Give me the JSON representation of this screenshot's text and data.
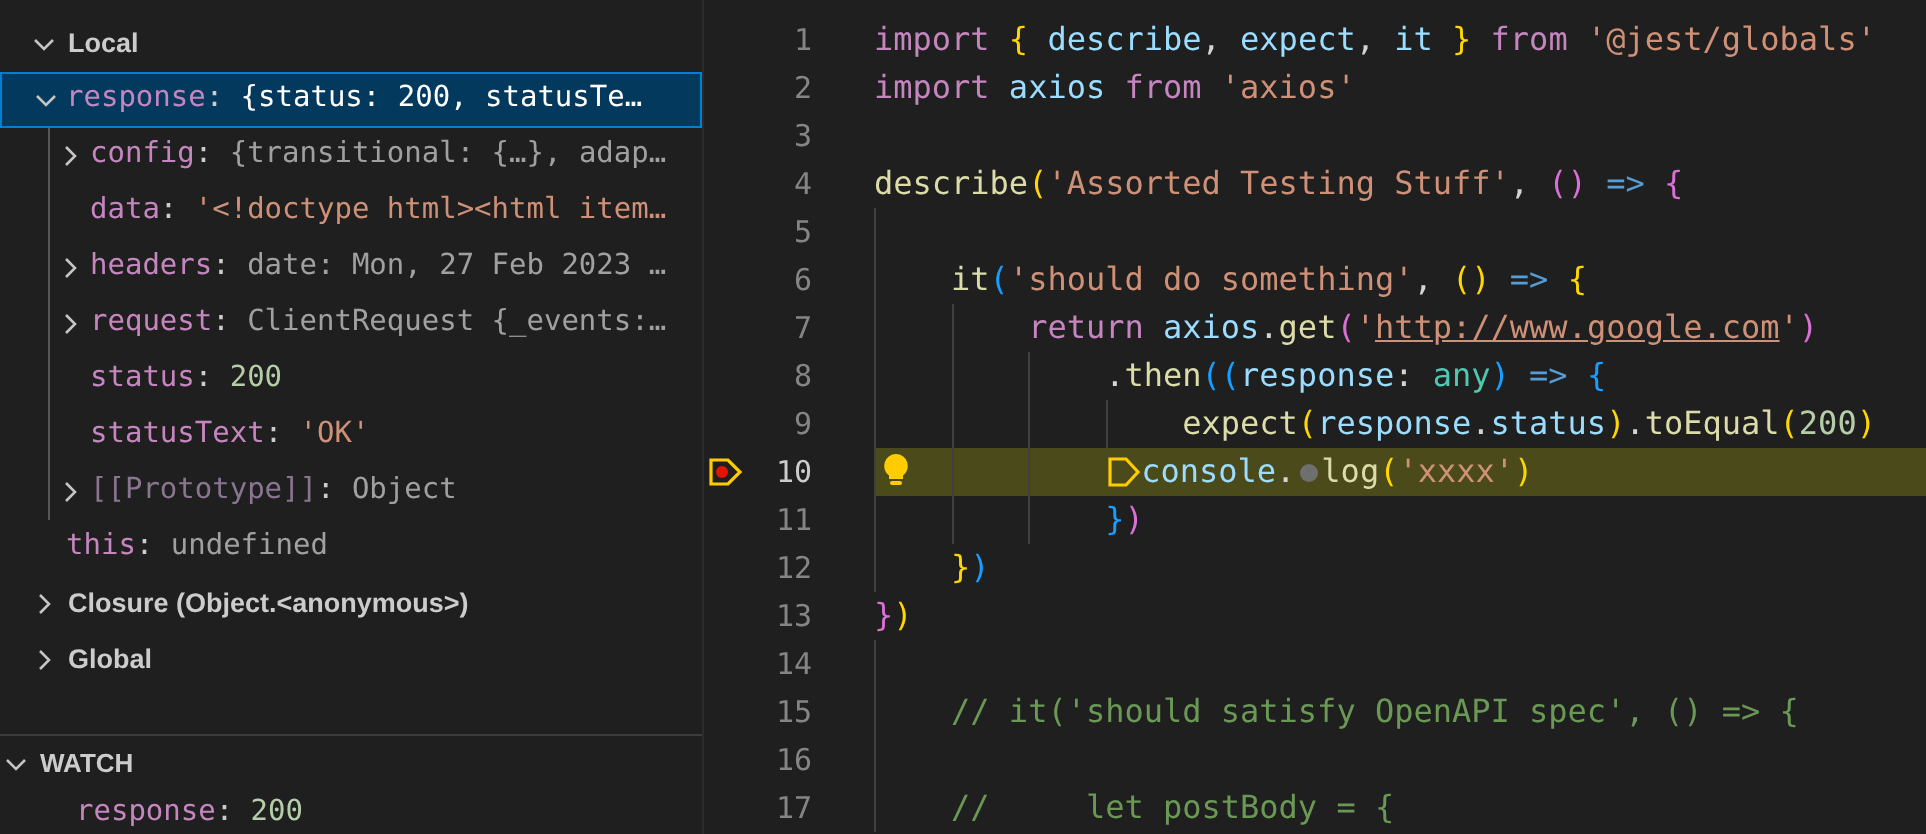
{
  "variables": {
    "scopes": [
      {
        "label": "Local",
        "expanded": true,
        "children": [
          {
            "name": "response",
            "separator": ":",
            "value": "{status: 200, statusTe…",
            "kind": "preview",
            "internal": false,
            "expanded": true,
            "selected": true,
            "children": [
              {
                "name": "config",
                "separator": ":",
                "value": "{transitional: {…}, adap…",
                "kind": "preview",
                "internal": false,
                "expanded": false,
                "selected": false
              },
              {
                "name": "data",
                "separator": ":",
                "value": "'<!doctype html><html item…",
                "kind": "string",
                "internal": false,
                "selected": false
              },
              {
                "name": "headers",
                "separator": ":",
                "value": "date: Mon, 27 Feb 2023 …",
                "kind": "preview",
                "internal": false,
                "expanded": false,
                "selected": false
              },
              {
                "name": "request",
                "separator": ":",
                "value": "ClientRequest {_events:…",
                "kind": "preview",
                "internal": false,
                "expanded": false,
                "selected": false
              },
              {
                "name": "status",
                "separator": ":",
                "value": "200",
                "kind": "number",
                "internal": false,
                "selected": false
              },
              {
                "name": "statusText",
                "separator": ":",
                "value": "'OK'",
                "kind": "string",
                "internal": false,
                "selected": false
              },
              {
                "name": "[[Prototype]]",
                "separator": ":",
                "value": "Object",
                "kind": "preview",
                "internal": true,
                "expanded": false,
                "selected": false
              }
            ]
          },
          {
            "name": "this",
            "separator": ":",
            "value": "undefined",
            "kind": "preview",
            "internal": false,
            "selected": false
          }
        ]
      },
      {
        "label": "Closure (Object.<anonymous>)",
        "expanded": false
      },
      {
        "label": "Global",
        "expanded": false
      }
    ]
  },
  "watch": {
    "label": "WATCH",
    "expanded": true,
    "items": [
      {
        "name": "response",
        "separator": ":",
        "value": "200",
        "kind": "number"
      }
    ]
  },
  "editor": {
    "lines": [
      {
        "number": "1",
        "tokens": [
          {
            "kind": "kw",
            "text": "import"
          },
          {
            "kind": "b1",
            "text": " {"
          },
          {
            "kind": "var",
            "text": " describe"
          },
          {
            "kind": "plain",
            "text": ","
          },
          {
            "kind": "var",
            "text": " expect"
          },
          {
            "kind": "plain",
            "text": ","
          },
          {
            "kind": "var",
            "text": " it"
          },
          {
            "kind": "b1",
            "text": " }"
          },
          {
            "kind": "kw",
            "text": " from"
          },
          {
            "kind": "str",
            "text": " '@jest/globals'"
          }
        ]
      },
      {
        "number": "2",
        "tokens": [
          {
            "kind": "kw",
            "text": "import"
          },
          {
            "kind": "var",
            "text": " axios"
          },
          {
            "kind": "kw",
            "text": " from"
          },
          {
            "kind": "str",
            "text": " 'axios'"
          }
        ]
      },
      {
        "number": "3"
      },
      {
        "number": "4",
        "tokens": [
          {
            "kind": "fn",
            "text": "describe"
          },
          {
            "kind": "b1",
            "text": "("
          },
          {
            "kind": "str",
            "text": "'Assorted Testing Stuff'"
          },
          {
            "kind": "plain",
            "text": ","
          },
          {
            "kind": "b2",
            "text": " ()"
          },
          {
            "kind": "op",
            "text": " =>"
          },
          {
            "kind": "b2",
            "text": " {"
          }
        ]
      },
      {
        "number": "5"
      },
      {
        "number": "6",
        "tokens": [
          {
            "kind": "fn",
            "text": "    it"
          },
          {
            "kind": "b3",
            "text": "("
          },
          {
            "kind": "str",
            "text": "'should do something'"
          },
          {
            "kind": "plain",
            "text": ","
          },
          {
            "kind": "b1",
            "text": " ()"
          },
          {
            "kind": "op",
            "text": " =>"
          },
          {
            "kind": "b1",
            "text": " {"
          }
        ]
      },
      {
        "number": "7",
        "tokens": [
          {
            "kind": "kw",
            "text": "        return"
          },
          {
            "kind": "var",
            "text": " axios"
          },
          {
            "kind": "plain",
            "text": "."
          },
          {
            "kind": "fn",
            "text": "get"
          },
          {
            "kind": "b2",
            "text": "("
          },
          {
            "kind": "str",
            "text": "'"
          },
          {
            "kind": "url",
            "text": "http://www.google.com"
          },
          {
            "kind": "str",
            "text": "'"
          },
          {
            "kind": "b2",
            "text": ")"
          }
        ]
      },
      {
        "number": "8",
        "tokens": [
          {
            "kind": "plain",
            "text": "            ."
          },
          {
            "kind": "fn",
            "text": "then"
          },
          {
            "kind": "b3",
            "text": "(("
          },
          {
            "kind": "var",
            "text": "response"
          },
          {
            "kind": "plain",
            "text": ":"
          },
          {
            "kind": "type",
            "text": " any"
          },
          {
            "kind": "b3",
            "text": ")"
          },
          {
            "kind": "op",
            "text": " =>"
          },
          {
            "kind": "b3",
            "text": " {"
          }
        ]
      },
      {
        "number": "9",
        "tokens": [
          {
            "kind": "fn",
            "text": "                expect"
          },
          {
            "kind": "b1",
            "text": "("
          },
          {
            "kind": "var",
            "text": "response"
          },
          {
            "kind": "plain",
            "text": "."
          },
          {
            "kind": "var",
            "text": "status"
          },
          {
            "kind": "b1",
            "text": ")"
          },
          {
            "kind": "plain",
            "text": "."
          },
          {
            "kind": "fn",
            "text": "toEqual"
          },
          {
            "kind": "b1",
            "text": "("
          },
          {
            "kind": "num",
            "text": "200"
          },
          {
            "kind": "b1",
            "text": ")"
          }
        ]
      },
      {
        "number": "10",
        "current": true,
        "breakpoint": true,
        "lightbulb": true,
        "tokens": [
          {
            "kind": "stop-marker"
          },
          {
            "kind": "var",
            "text": "              console"
          },
          {
            "kind": "plain",
            "text": "."
          },
          {
            "kind": "bp-dot"
          },
          {
            "kind": "fn",
            "text": "log"
          },
          {
            "kind": "b1",
            "text": "("
          },
          {
            "kind": "str",
            "text": "'xxxx'"
          },
          {
            "kind": "b1",
            "text": ")"
          }
        ]
      },
      {
        "number": "11",
        "tokens": [
          {
            "kind": "b3",
            "text": "            }"
          },
          {
            "kind": "b2",
            "text": ")"
          }
        ]
      },
      {
        "number": "12",
        "tokens": [
          {
            "kind": "b1",
            "text": "    }"
          },
          {
            "kind": "b3",
            "text": ")"
          }
        ]
      },
      {
        "number": "13",
        "tokens": [
          {
            "kind": "b2",
            "text": "}"
          },
          {
            "kind": "b1",
            "text": ")"
          }
        ]
      },
      {
        "number": "14"
      },
      {
        "number": "15",
        "tokens": [
          {
            "kind": "comment",
            "text": "    // it('should satisfy OpenAPI spec', () => {"
          }
        ]
      },
      {
        "number": "16"
      },
      {
        "number": "17",
        "tokens": [
          {
            "kind": "comment",
            "text": "    //     let postBody = {"
          }
        ]
      }
    ]
  }
}
